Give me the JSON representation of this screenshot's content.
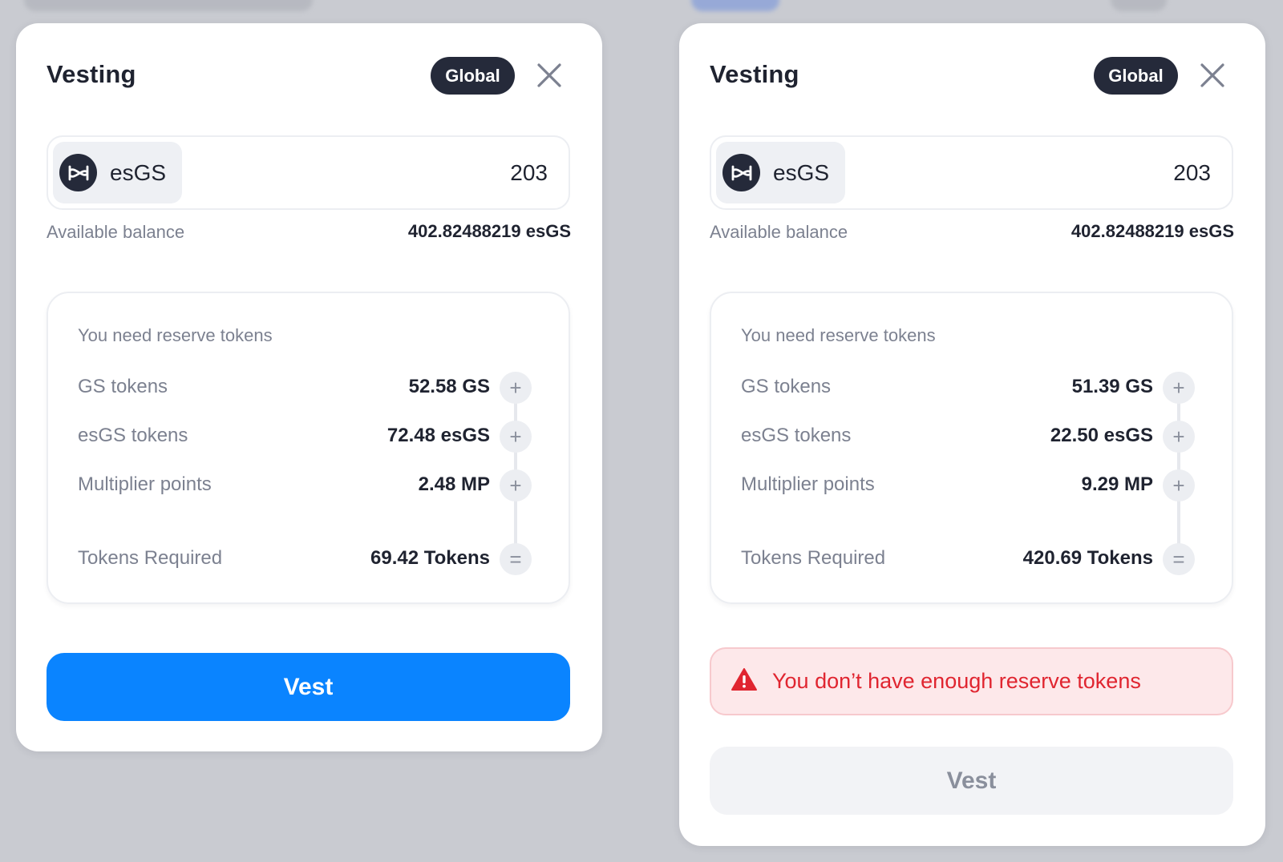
{
  "colors": {
    "primary_button": "#0a84ff",
    "badge_bg": "#252a3a",
    "error_text": "#e02530",
    "error_bg": "#fde8ea",
    "disabled_button": "#f2f3f6"
  },
  "modals": [
    {
      "title": "Vesting",
      "scope_badge": "Global",
      "close_icon": "close-icon",
      "token": {
        "name": "esGS",
        "icon": "esgs-token-icon",
        "amount": "203"
      },
      "balance": {
        "label": "Available balance",
        "value": "402.82488219 esGS"
      },
      "reserve": {
        "title": "You need reserve tokens",
        "rows": [
          {
            "label": "GS tokens",
            "value": "52.58 GS",
            "op": "+"
          },
          {
            "label": "esGS tokens",
            "value": "72.48 esGS",
            "op": "+"
          },
          {
            "label": "Multiplier points",
            "value": "2.48 MP",
            "op": "+"
          },
          {
            "label": "Tokens Required",
            "value": "69.42 Tokens",
            "op": "="
          }
        ]
      },
      "alert": null,
      "vest_button": {
        "label": "Vest",
        "enabled": true
      }
    },
    {
      "title": "Vesting",
      "scope_badge": "Global",
      "close_icon": "close-icon",
      "token": {
        "name": "esGS",
        "icon": "esgs-token-icon",
        "amount": "203"
      },
      "balance": {
        "label": "Available balance",
        "value": "402.82488219 esGS"
      },
      "reserve": {
        "title": "You need reserve tokens",
        "rows": [
          {
            "label": "GS tokens",
            "value": "51.39 GS",
            "op": "+"
          },
          {
            "label": "esGS tokens",
            "value": "22.50 esGS",
            "op": "+"
          },
          {
            "label": "Multiplier points",
            "value": "9.29 MP",
            "op": "+"
          },
          {
            "label": "Tokens Required",
            "value": "420.69 Tokens",
            "op": "="
          }
        ]
      },
      "alert": {
        "icon": "warning-icon",
        "text": "You don’t have enough reserve tokens"
      },
      "vest_button": {
        "label": "Vest",
        "enabled": false
      }
    }
  ]
}
